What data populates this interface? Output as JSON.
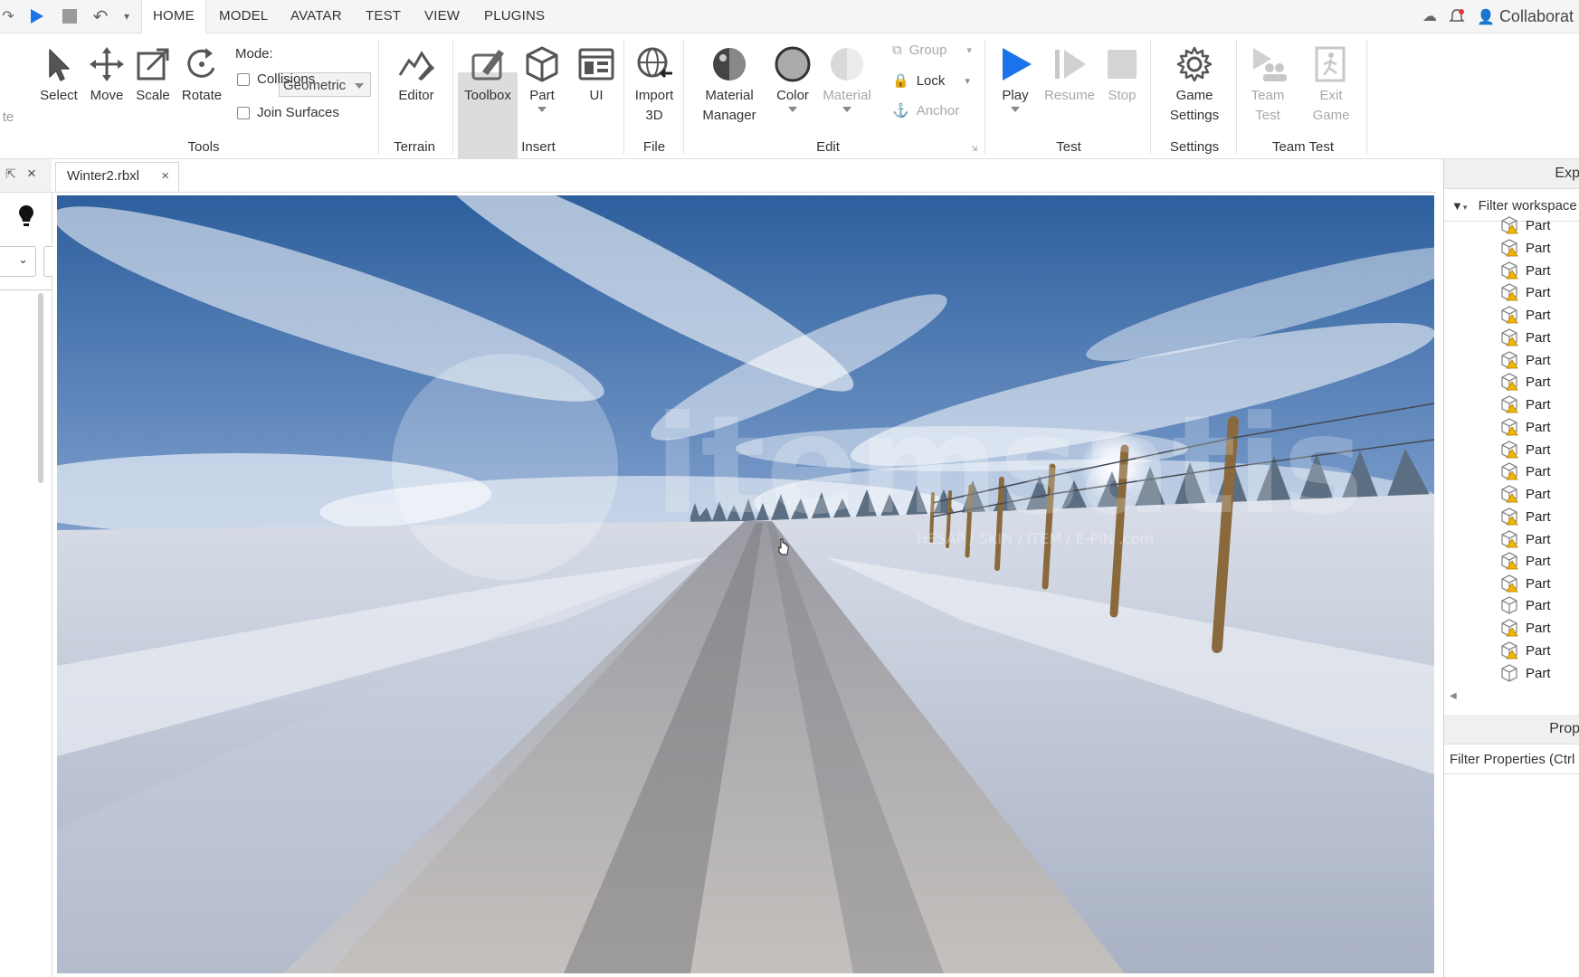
{
  "menu": {
    "tabs": [
      "HOME",
      "MODEL",
      "AVATAR",
      "TEST",
      "VIEW",
      "PLUGINS"
    ],
    "active": "HOME",
    "collaborate_label": "Collaborat"
  },
  "ribbon": {
    "tools": {
      "select": "Select",
      "move": "Move",
      "scale": "Scale",
      "rotate": "Rotate",
      "mode_label": "Mode:",
      "mode_value": "Geometric",
      "collisions": "Collisions",
      "join_surfaces": "Join Surfaces",
      "group_label": "Tools",
      "partial_left": "te"
    },
    "terrain": {
      "editor": "Editor",
      "group_label": "Terrain"
    },
    "insert": {
      "toolbox": "Toolbox",
      "part": "Part",
      "ui": "UI",
      "group_label": "Insert"
    },
    "file": {
      "import_line1": "Import",
      "import_line2": "3D",
      "group_label": "File"
    },
    "edit": {
      "material_manager_line1": "Material",
      "material_manager_line2": "Manager",
      "color": "Color",
      "material": "Material",
      "group": "Group",
      "lock": "Lock",
      "anchor": "Anchor",
      "group_label": "Edit"
    },
    "test": {
      "play": "Play",
      "resume": "Resume",
      "stop": "Stop",
      "group_label": "Test"
    },
    "settings": {
      "game_settings_line1": "Game",
      "game_settings_line2": "Settings",
      "group_label": "Settings"
    },
    "team_test": {
      "team_test_line1": "Team",
      "team_test_line2": "Test",
      "exit_game_line1": "Exit",
      "exit_game_line2": "Game",
      "group_label": "Team Test"
    }
  },
  "document": {
    "tab_title": "Winter2.rbxl",
    "close_glyph": "×"
  },
  "viewport": {
    "watermark": "itemsatis",
    "watermark_sub": "HESAP / SKIN / ITEM / E-PIN  .com"
  },
  "explorer": {
    "title": "Exp",
    "filter_placeholder": "Filter workspace",
    "items": [
      "Part",
      "Part",
      "Part",
      "Part",
      "Part",
      "Part",
      "Part",
      "Part",
      "Part",
      "Part",
      "Part",
      "Part",
      "Part",
      "Part",
      "Part",
      "Part",
      "Part",
      "Part",
      "Part",
      "Part",
      "Part"
    ]
  },
  "properties": {
    "title": "Prop",
    "filter_placeholder": "Filter Properties (Ctrl"
  },
  "colors": {
    "accent_blue": "#1a73e8",
    "ribbon_bg": "#ffffff",
    "menubar_bg": "#f5f5f5"
  }
}
